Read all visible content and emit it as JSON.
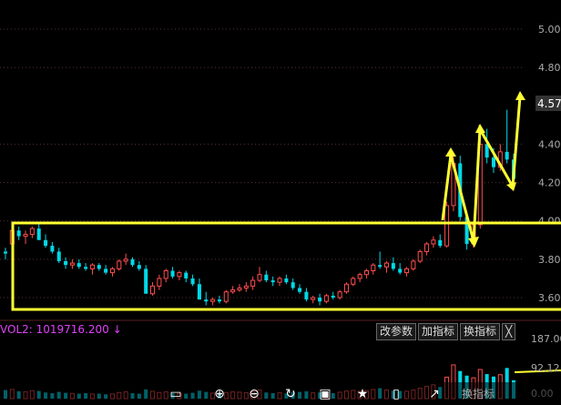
{
  "main_chart": {
    "y_ticks": [
      "5.00",
      "4.80",
      "4.40",
      "4.20",
      "4.00",
      "3.80",
      "3.60"
    ],
    "current_price": "4.57",
    "colors": {
      "up": "#ff4d4d",
      "down": "#00d8e8",
      "annotation": "#ffff33",
      "grid": "#553333",
      "price_box": "#333333"
    }
  },
  "volume_panel": {
    "label": "VOL2: 1019716.200",
    "arrow": "↓",
    "y_ticks": [
      "187.00",
      "92.12",
      "0.00"
    ],
    "buttons": [
      "改参数",
      "加指标",
      "换指标",
      "╳"
    ]
  },
  "toolbar": {
    "icons": [
      "screen-icon",
      "zoom-in-icon",
      "zoom-out-icon",
      "refresh-icon",
      "save-icon",
      "star-icon",
      "phone-icon",
      "share-icon"
    ],
    "partial_label": "换指标"
  },
  "chart_data": {
    "type": "candlestick",
    "ylim": [
      3.52,
      5.04
    ],
    "candles": [
      [
        3.84,
        3.86,
        3.8,
        3.83
      ],
      [
        3.88,
        3.97,
        3.86,
        3.95
      ],
      [
        3.95,
        3.97,
        3.9,
        3.92
      ],
      [
        3.92,
        3.95,
        3.88,
        3.93
      ],
      [
        3.93,
        3.97,
        3.91,
        3.96
      ],
      [
        3.96,
        3.99,
        3.92,
        3.9
      ],
      [
        3.9,
        3.93,
        3.86,
        3.87
      ],
      [
        3.87,
        3.89,
        3.83,
        3.84
      ],
      [
        3.84,
        3.86,
        3.78,
        3.79
      ],
      [
        3.79,
        3.81,
        3.75,
        3.77
      ],
      [
        3.77,
        3.8,
        3.75,
        3.78
      ],
      [
        3.78,
        3.8,
        3.75,
        3.76
      ],
      [
        3.76,
        3.78,
        3.74,
        3.75
      ],
      [
        3.75,
        3.78,
        3.72,
        3.77
      ],
      [
        3.77,
        3.78,
        3.74,
        3.75
      ],
      [
        3.75,
        3.77,
        3.72,
        3.73
      ],
      [
        3.73,
        3.76,
        3.71,
        3.75
      ],
      [
        3.75,
        3.8,
        3.74,
        3.79
      ],
      [
        3.79,
        3.83,
        3.77,
        3.8
      ],
      [
        3.8,
        3.81,
        3.76,
        3.77
      ],
      [
        3.77,
        3.79,
        3.74,
        3.75
      ],
      [
        3.75,
        3.77,
        3.66,
        3.62
      ],
      [
        3.62,
        3.68,
        3.61,
        3.66
      ],
      [
        3.66,
        3.72,
        3.64,
        3.7
      ],
      [
        3.7,
        3.75,
        3.68,
        3.74
      ],
      [
        3.74,
        3.76,
        3.7,
        3.71
      ],
      [
        3.71,
        3.74,
        3.69,
        3.73
      ],
      [
        3.73,
        3.74,
        3.68,
        3.7
      ],
      [
        3.7,
        3.72,
        3.66,
        3.67
      ],
      [
        3.67,
        3.7,
        3.6,
        3.59
      ],
      [
        3.59,
        3.63,
        3.56,
        3.58
      ],
      [
        3.58,
        3.6,
        3.56,
        3.59
      ],
      [
        3.59,
        3.61,
        3.57,
        3.58
      ],
      [
        3.58,
        3.64,
        3.57,
        3.63
      ],
      [
        3.63,
        3.66,
        3.62,
        3.64
      ],
      [
        3.64,
        3.67,
        3.63,
        3.65
      ],
      [
        3.65,
        3.68,
        3.63,
        3.66
      ],
      [
        3.66,
        3.71,
        3.64,
        3.69
      ],
      [
        3.69,
        3.76,
        3.68,
        3.72
      ],
      [
        3.72,
        3.74,
        3.68,
        3.69
      ],
      [
        3.69,
        3.71,
        3.66,
        3.68
      ],
      [
        3.68,
        3.71,
        3.66,
        3.7
      ],
      [
        3.7,
        3.72,
        3.67,
        3.68
      ],
      [
        3.68,
        3.7,
        3.64,
        3.65
      ],
      [
        3.65,
        3.67,
        3.62,
        3.63
      ],
      [
        3.63,
        3.65,
        3.58,
        3.59
      ],
      [
        3.59,
        3.61,
        3.57,
        3.6
      ],
      [
        3.6,
        3.62,
        3.56,
        3.58
      ],
      [
        3.58,
        3.62,
        3.57,
        3.61
      ],
      [
        3.61,
        3.63,
        3.59,
        3.6
      ],
      [
        3.6,
        3.64,
        3.59,
        3.63
      ],
      [
        3.63,
        3.68,
        3.62,
        3.67
      ],
      [
        3.67,
        3.71,
        3.66,
        3.7
      ],
      [
        3.7,
        3.73,
        3.68,
        3.72
      ],
      [
        3.72,
        3.75,
        3.7,
        3.74
      ],
      [
        3.74,
        3.78,
        3.72,
        3.77
      ],
      [
        3.77,
        3.84,
        3.75,
        3.76
      ],
      [
        3.76,
        3.79,
        3.73,
        3.78
      ],
      [
        3.78,
        3.81,
        3.74,
        3.75
      ],
      [
        3.75,
        3.78,
        3.72,
        3.73
      ],
      [
        3.73,
        3.76,
        3.71,
        3.75
      ],
      [
        3.75,
        3.8,
        3.74,
        3.79
      ],
      [
        3.79,
        3.85,
        3.78,
        3.84
      ],
      [
        3.84,
        3.89,
        3.82,
        3.88
      ],
      [
        3.88,
        3.92,
        3.86,
        3.9
      ],
      [
        3.9,
        3.93,
        3.86,
        3.87
      ],
      [
        3.87,
        4.1,
        3.86,
        4.08
      ],
      [
        4.08,
        4.35,
        4.05,
        4.3
      ],
      [
        4.3,
        4.34,
        4.0,
        4.02
      ],
      [
        4.02,
        4.05,
        3.85,
        3.88
      ],
      [
        3.88,
        4.0,
        3.86,
        3.98
      ],
      [
        3.98,
        4.42,
        3.96,
        4.4
      ],
      [
        4.4,
        4.48,
        4.3,
        4.33
      ],
      [
        4.33,
        4.38,
        4.25,
        4.28
      ],
      [
        4.28,
        4.4,
        4.26,
        4.36
      ],
      [
        4.36,
        4.58,
        4.3,
        4.32
      ],
      [
        4.32,
        4.35,
        4.18,
        4.22
      ]
    ],
    "volume": [
      28,
      30,
      24,
      22,
      26,
      25,
      20,
      18,
      22,
      19,
      17,
      16,
      18,
      15,
      16,
      14,
      15,
      20,
      22,
      18,
      16,
      30,
      24,
      20,
      22,
      18,
      17,
      16,
      19,
      26,
      22,
      18,
      17,
      20,
      22,
      21,
      19,
      23,
      28,
      20,
      18,
      19,
      17,
      21,
      22,
      24,
      19,
      20,
      22,
      18,
      21,
      25,
      27,
      24,
      26,
      30,
      34,
      28,
      26,
      25,
      24,
      28,
      34,
      40,
      45,
      38,
      70,
      110,
      90,
      75,
      68,
      95,
      80,
      72,
      78,
      100,
      60
    ]
  }
}
